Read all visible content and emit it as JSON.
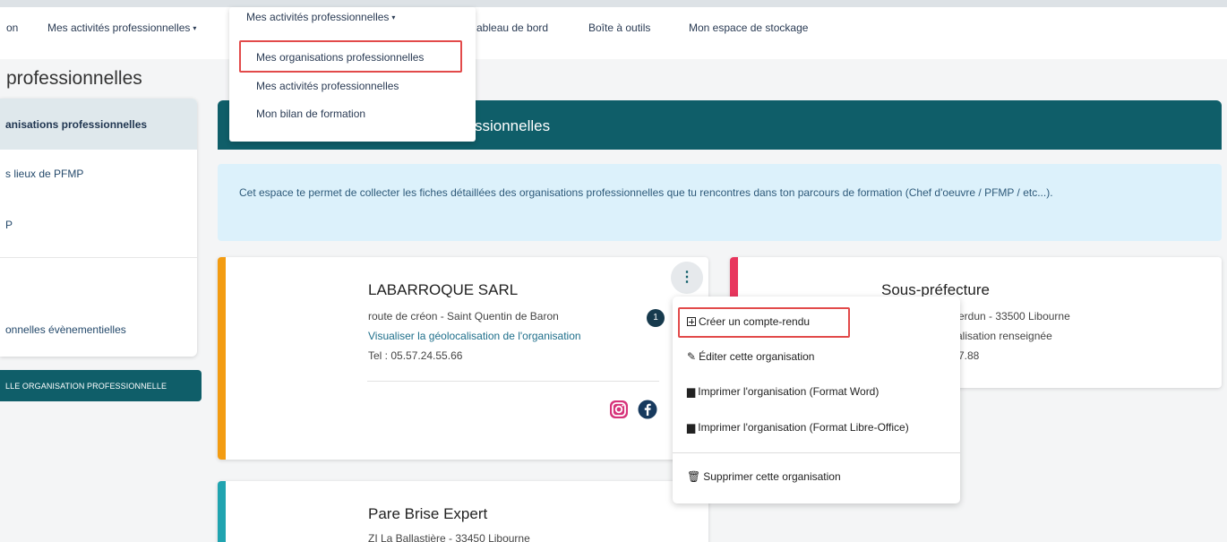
{
  "nav": {
    "items": [
      "on",
      "Mes activités professionnelles",
      "ableau de bord",
      "Boîte à outils",
      "Mon espace de stockage"
    ],
    "caret": "▾"
  },
  "page_title": "professionnelles",
  "sidebar": {
    "items": [
      "anisations professionnelles",
      "s lieux de PFMP",
      "P",
      "onnelles évènementielles"
    ],
    "new_button": "LLE ORGANISATION PROFESSIONNELLE"
  },
  "dropdown": {
    "header": "Mes activités professionnelles",
    "items": [
      "Mes organisations professionnelles",
      "Mes activités professionnelles",
      "Mon bilan de formation"
    ]
  },
  "banner": {
    "title": "ssionnelles"
  },
  "info_text": "Cet espace te permet de collecter les fiches détaillées des organisations professionnelles que tu rencontres dans ton parcours de formation (Chef d'oeuvre / PFMP / etc...).",
  "cards": [
    {
      "name": "LABARROQUE SARL",
      "address": "route de créon - Saint Quentin de Baron",
      "geo": "Visualiser la géolocalisation de l'organisation",
      "tel": "Tel : 05.57.24.55.66",
      "badge": "1",
      "color": "#f39c12"
    },
    {
      "name": "Sous-préfecture",
      "address": "erdun - 33500 Libourne",
      "geo": "alisation renseignée",
      "tel": "7.88",
      "color": "#e8365d"
    },
    {
      "name": "Pare Brise Expert",
      "address": "ZI La Ballastière - 33450 Libourne",
      "color": "#20a4b0"
    }
  ],
  "card_menu": {
    "items": [
      "Créer un compte-rendu",
      "Éditer cette organisation",
      "Imprimer l'organisation (Format Word)",
      "Imprimer l'organisation (Format Libre-Office)",
      "Supprimer cette organisation"
    ]
  },
  "colors": {
    "teal": "#0f5e69",
    "highlight": "#e24a4a",
    "info_bg": "#dcf1fb"
  }
}
